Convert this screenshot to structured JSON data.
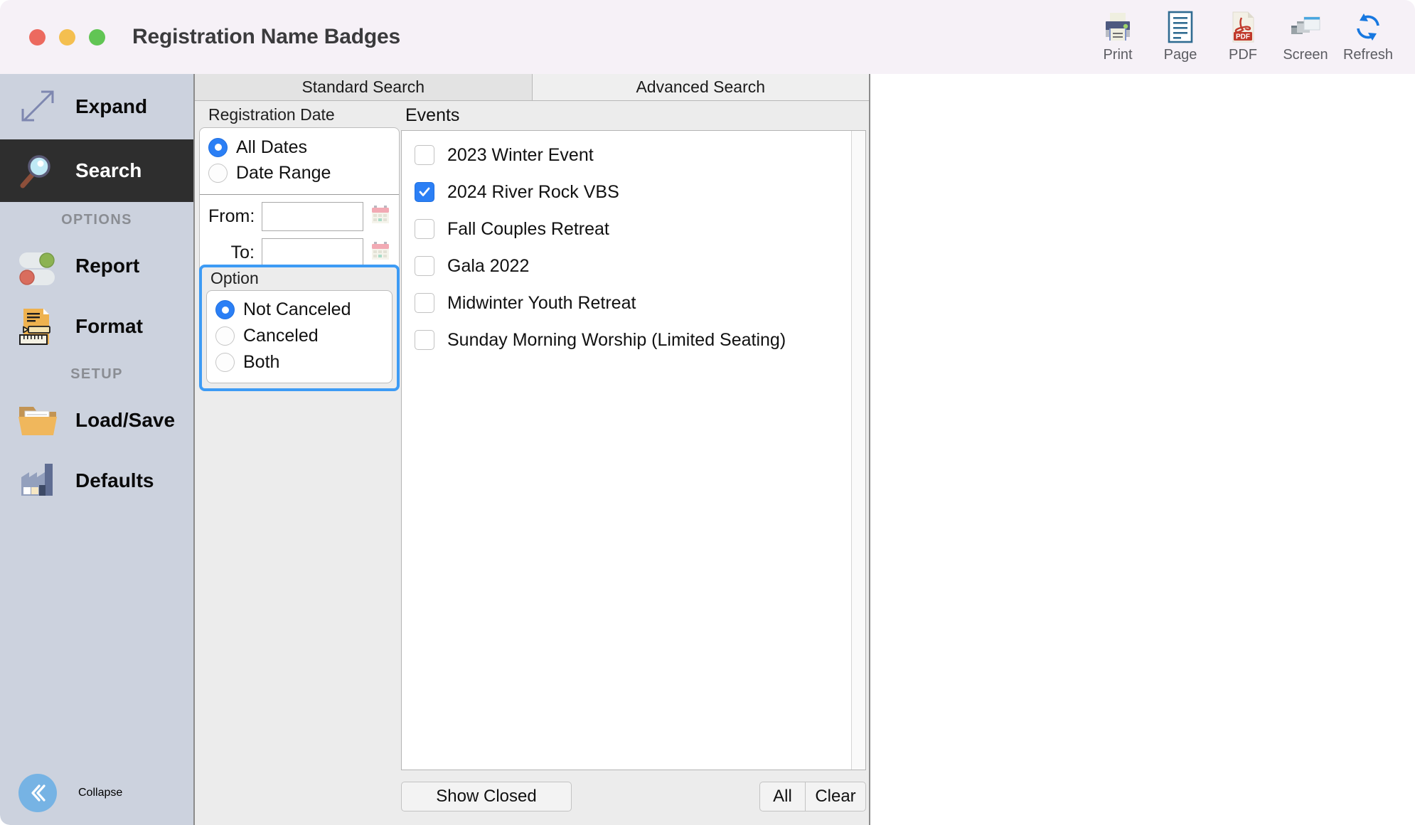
{
  "window": {
    "title": "Registration Name Badges",
    "traffic_lights": [
      "close",
      "minimize",
      "maximize"
    ]
  },
  "toolbar": {
    "items": [
      {
        "label": "Print",
        "icon": "printer-icon"
      },
      {
        "label": "Page",
        "icon": "page-icon"
      },
      {
        "label": "PDF",
        "icon": "pdf-icon",
        "badge": "PDF"
      },
      {
        "label": "Screen",
        "icon": "screen-icon"
      },
      {
        "label": "Refresh",
        "icon": "refresh-icon"
      }
    ]
  },
  "sidebar": {
    "top_items": [
      {
        "label": "Expand",
        "icon": "expand-arrows-icon",
        "active": false
      },
      {
        "label": "Search",
        "icon": "magnifier-icon",
        "active": true
      }
    ],
    "groups": [
      {
        "title": "OPTIONS",
        "items": [
          {
            "label": "Report",
            "icon": "toggles-icon"
          },
          {
            "label": "Format",
            "icon": "format-document-icon"
          }
        ]
      },
      {
        "title": "SETUP",
        "items": [
          {
            "label": "Load/Save",
            "icon": "folder-icon"
          },
          {
            "label": "Defaults",
            "icon": "factory-icon"
          }
        ]
      }
    ],
    "collapse": {
      "label": "Collapse",
      "icon": "chevron-double-left-icon"
    }
  },
  "tabs": [
    {
      "label": "Standard Search",
      "active": true
    },
    {
      "label": "Advanced Search",
      "active": false
    }
  ],
  "registration_date": {
    "legend": "Registration Date",
    "options": [
      {
        "label": "All Dates",
        "selected": true
      },
      {
        "label": "Date Range",
        "selected": false
      }
    ],
    "from": {
      "label": "From:",
      "value": "",
      "calendar_icon": "calendar-icon"
    },
    "to": {
      "label": "To:",
      "value": "",
      "calendar_icon": "calendar-icon"
    }
  },
  "option_group": {
    "legend": "Option",
    "focused": true,
    "focus_color": "#3d9bf5",
    "options": [
      {
        "label": "Not Canceled",
        "selected": true
      },
      {
        "label": "Canceled",
        "selected": false
      },
      {
        "label": "Both",
        "selected": false
      }
    ]
  },
  "events": {
    "label": "Events",
    "items": [
      {
        "name": "2023 Winter Event",
        "checked": false
      },
      {
        "name": "2024 River Rock VBS",
        "checked": true
      },
      {
        "name": "Fall Couples Retreat",
        "checked": false
      },
      {
        "name": "Gala 2022",
        "checked": false
      },
      {
        "name": "Midwinter Youth Retreat",
        "checked": false
      },
      {
        "name": "Sunday Morning Worship (Limited Seating)",
        "checked": false
      }
    ]
  },
  "footer": {
    "show_closed": "Show Closed",
    "all": "All",
    "clear": "Clear"
  },
  "colors": {
    "accent_blue": "#2b7ff5",
    "sidebar_bg": "#ccd2de",
    "titlebar_bg": "#f6f1f7",
    "active_row": "#2e2e2e"
  }
}
